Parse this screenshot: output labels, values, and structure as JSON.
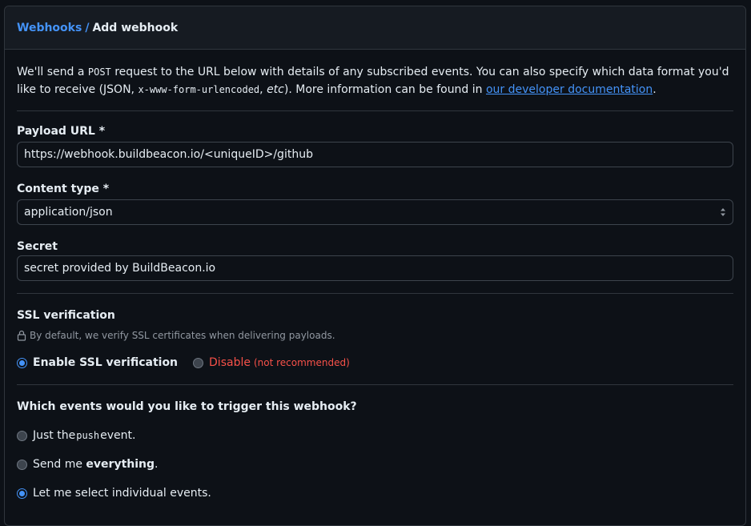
{
  "header": {
    "crumb_parent": "Webhooks",
    "crumb_sep": "/",
    "crumb_current": "Add webhook"
  },
  "intro": {
    "part1": "We'll send a ",
    "code1": "POST",
    "part2": " request to the URL below with details of any subscribed events. You can also specify which data format you'd like to receive (JSON, ",
    "code2": "x-www-form-urlencoded",
    "part3": ", ",
    "etc": "etc",
    "part4": "). More information can be found in ",
    "link": "our developer documentation",
    "part5": "."
  },
  "payload_url": {
    "label": "Payload URL *",
    "value": "https://webhook.buildbeacon.io/<uniqueID>/github"
  },
  "content_type": {
    "label": "Content type *",
    "value": "application/json"
  },
  "secret": {
    "label": "Secret",
    "value": "secret provided by BuildBeacon.io"
  },
  "ssl": {
    "title": "SSL verification",
    "note": "By default, we verify SSL certificates when delivering payloads.",
    "enable_label": "Enable SSL verification",
    "disable_label": "Disable",
    "disable_sub": "(not recommended)",
    "selected": "enable"
  },
  "events": {
    "title": "Which events would you like to trigger this webhook?",
    "opt1_pre": "Just the ",
    "opt1_code": "push",
    "opt1_post": " event.",
    "opt2_pre": "Send me ",
    "opt2_strong": "everything",
    "opt2_post": ".",
    "opt3": "Let me select individual events.",
    "selected": "individual"
  },
  "colors": {
    "accent": "#4493f8",
    "danger": "#f85149",
    "background": "#0d1117",
    "border": "#30363d"
  }
}
